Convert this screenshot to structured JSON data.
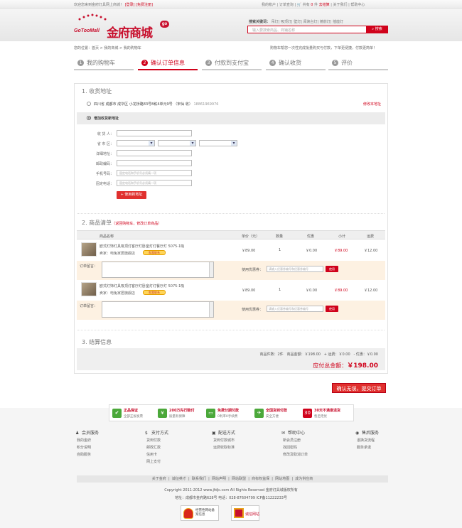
{
  "topbar": {
    "welcome": "欢迎您来到金府灯具网上商城！",
    "login": "[登录]",
    "register": "[免费注册]",
    "links": [
      "我的帐户",
      "订单查询"
    ],
    "cart_label": "共有",
    "cart_count": "0",
    "cart_unit": "件",
    "checkout": "去结算",
    "about": "关于我们",
    "help": "帮助中心"
  },
  "header": {
    "logo_en": "GoTooMall",
    "logo_cn": "金府商城",
    "logo_badge": "go",
    "hot_label": "搜索关键词：",
    "hot_keywords": [
      "吊灯",
      "吸顶灯",
      "壁灯",
      "阅读台灯",
      "镜前灯",
      "插座灯"
    ],
    "search_placeholder": "输入要搜索商品、商铺名称",
    "search_button": "搜索"
  },
  "breadcrumb": [
    "您的位置：",
    "首页",
    "我的商城",
    "我的购物车"
  ],
  "notice": "购物车帮您一次性完成批量购买与付款，下单更便捷，付款更简单！",
  "steps": [
    {
      "num": "1",
      "label": "我的购物车"
    },
    {
      "num": "2",
      "label": "确认订单信息"
    },
    {
      "num": "3",
      "label": "付款到支付宝"
    },
    {
      "num": "4",
      "label": "确认收货"
    },
    {
      "num": "5",
      "label": "评价"
    }
  ],
  "address": {
    "title": "1. 收货地址",
    "existing": "四川省 成都市 成华区 小龙桥路83号8栋4单元9号 （宋仙 收）",
    "existing_phone": "18861969976",
    "modify": "修改本地址",
    "new_title": "增加收货新地址",
    "labels": {
      "receiver": "收 货 人：",
      "region": "省 市 区：",
      "detail": "详细地址：",
      "zip": "邮政编码：",
      "mobile": "手机号码：",
      "tel": "固定电话："
    },
    "mobile_placeholder": "固定电话和手机号必须填一项",
    "tel_placeholder": "固定电话和手机号必须填一项",
    "use_button": "+ 使用新地址"
  },
  "goods": {
    "title": "2. 商品清单",
    "links": "（返回购物车，修改订单商品）",
    "headers": {
      "name": "商品名称",
      "price": "单价（元）",
      "qty": "数量",
      "discount": "优惠",
      "subtotal": "小计",
      "shipping": "运费"
    },
    "items": [
      {
        "name": "欧式灯饰灯具吸顶灯客厅灯卧室灯灯餐厅灯 5075-1吸",
        "shop": "卖家：电兔家居旗舰店",
        "price": "￥89.00",
        "qty": "1",
        "discount": "￥0.00",
        "subtotal": "￥89.00",
        "shipping": "￥12.00"
      },
      {
        "name": "欧式灯饰灯具吸顶灯客厅灯卧室灯灯餐厅灯 5075-1吸",
        "shop": "卖家：电兔家居旗舰店",
        "price": "￥89.00",
        "qty": "1",
        "discount": "￥0.00",
        "subtotal": "￥89.00",
        "shipping": "￥12.00"
      }
    ],
    "wangwang": "和我联系",
    "msg_label": "订单留言：",
    "coupon_label": "使用优惠券：",
    "coupon_placeholder": "请输入优惠券编号和优惠券编号",
    "coupon_button": "使用"
  },
  "settle": {
    "title": "3. 结算信息",
    "count_label": "商品件数：2件",
    "amount_label": "商品金额：",
    "amount": "￥198.00",
    "freight_label": "+ 运费：",
    "freight": "￥0.00",
    "discount_label": "- 优惠：",
    "discount": "￥0.00",
    "total_label": "应付总金额：",
    "total": "￥198.00",
    "confirm": "确认无误，提交订单"
  },
  "guarantee": [
    {
      "title": "正品保证",
      "sub": "全部正规发票",
      "icon": "✔"
    },
    {
      "title": "200万先行赔付",
      "sub": "质量有保障",
      "icon": "¥"
    },
    {
      "title": "免费分期付款",
      "sub": "0利率0手续费",
      "icon": "▭"
    },
    {
      "title": "全国货到付款",
      "sub": "安全方便",
      "icon": "✈"
    },
    {
      "title": "30天不满意退货",
      "sub": "售后无忧",
      "icon": "30"
    }
  ],
  "help": [
    {
      "title": "会员服务",
      "icon": "♟",
      "items": [
        "我的金府",
        "积分说明",
        "自助服务"
      ]
    },
    {
      "title": "支付方式",
      "icon": "$",
      "items": [
        "货到付款",
        "邮政汇款",
        "信用卡",
        "网上支付"
      ]
    },
    {
      "title": "配送方式",
      "icon": "▣",
      "items": [
        "货到付款城市",
        "运费收取标准"
      ]
    },
    {
      "title": "帮助中心",
      "icon": "✉",
      "items": [
        "新会员注册",
        "找回密码",
        "修改及取消订单"
      ]
    },
    {
      "title": "售后服务",
      "icon": "◉",
      "items": [
        "退换货流程",
        "服务承诺"
      ]
    }
  ],
  "footnav": [
    "关于金府",
    "诚征英才",
    "联系我们",
    "网站声明",
    "网站联盟",
    "商标权益保",
    "网站地图",
    "成为供应商"
  ],
  "copyright": "Copyright 2011-2012 www.jfdjc.com All Rights Reserved 金府灯具城版权所有",
  "contact": "地址：成都市金府路628号    电话：028-87604799    ICP备11222233号",
  "badges": [
    "经营性网站备案信息",
    "诚信网站"
  ]
}
